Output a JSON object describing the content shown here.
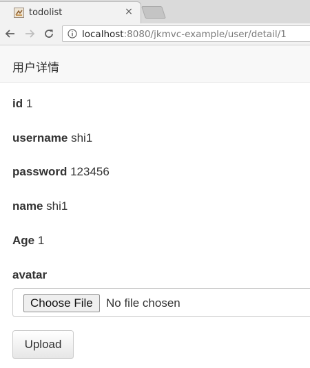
{
  "browser": {
    "tab": {
      "title": "todolist",
      "close_glyph": "×",
      "favicon": "page-favicon"
    },
    "toolbar": {
      "back_icon": "arrow-left-icon",
      "forward_icon": "arrow-right-icon",
      "reload_icon": "reload-icon",
      "info_icon": "info-icon",
      "url_host": "localhost",
      "url_rest": ":8080/jkmvc-example/user/detail/1"
    }
  },
  "page": {
    "header_title": "用户详情",
    "fields": [
      {
        "label": "id",
        "value": "1"
      },
      {
        "label": "username",
        "value": "shi1"
      },
      {
        "label": "password",
        "value": "123456"
      },
      {
        "label": "name",
        "value": "shi1"
      },
      {
        "label": "Age",
        "value": "1"
      }
    ],
    "avatar": {
      "label": "avatar",
      "choose_button": "Choose File",
      "no_file_text": "No file chosen"
    },
    "upload_button": "Upload"
  }
}
